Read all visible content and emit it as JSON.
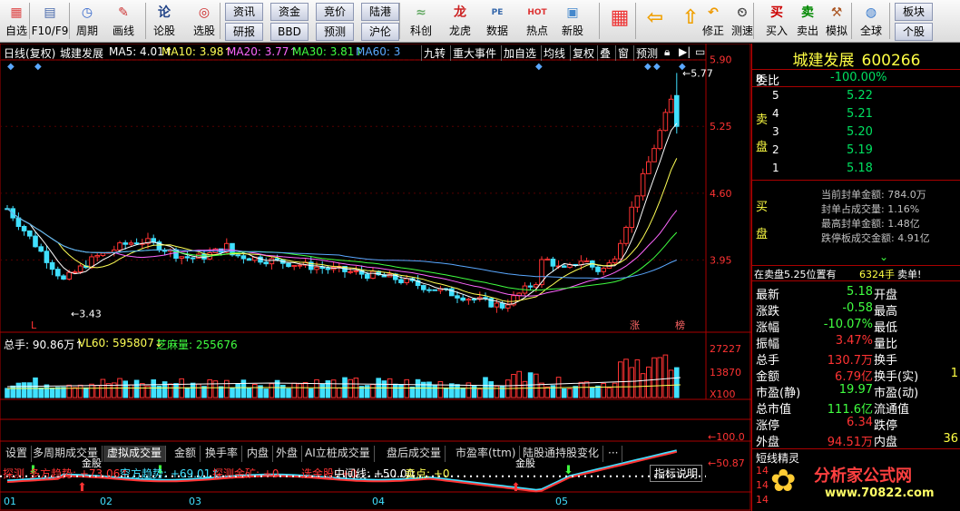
{
  "toolbar": {
    "items": [
      {
        "label": "自选",
        "icon": "grid-icon"
      },
      {
        "label": "F10/F9",
        "icon": "f10-icon"
      },
      {
        "label": "周期",
        "icon": "clock-icon"
      },
      {
        "label": "画线",
        "icon": "pencil-icon"
      },
      {
        "label": "论股",
        "icon": "discuss-icon"
      },
      {
        "label": "选股",
        "icon": "select-stock-icon"
      },
      {
        "label": "科创",
        "icon": "sci-tech-icon"
      },
      {
        "label": "龙虎",
        "icon": "dragon-tiger-icon"
      },
      {
        "label": "数据",
        "icon": "pe-data-icon"
      },
      {
        "label": "热点",
        "icon": "hot-icon"
      },
      {
        "label": "新股",
        "icon": "ipo-icon"
      },
      {
        "label": "修正",
        "icon": "undo-icon"
      },
      {
        "label": "测速",
        "icon": "speed-test-icon"
      },
      {
        "label": "买入",
        "icon": "buy-icon"
      },
      {
        "label": "卖出",
        "icon": "sell-icon"
      },
      {
        "label": "模拟",
        "icon": "hammer-icon"
      },
      {
        "label": "全球",
        "icon": "globe-icon"
      }
    ],
    "small_buttons": [
      "资讯",
      "资金",
      "竞价",
      "陆港",
      "研报",
      "BBD",
      "预测",
      "沪伦",
      "板块",
      "个股"
    ]
  },
  "header": {
    "period": "日线(复权)",
    "stock": "城建发展",
    "ma": [
      {
        "label": "MA5: 4.01",
        "color": "#ffffff"
      },
      {
        "label": "MA10: 3.98",
        "color": "#ffff55"
      },
      {
        "label": "MA20: 3.77",
        "color": "#ff66ff"
      },
      {
        "label": "MA30: 3.81",
        "color": "#40ff40"
      },
      {
        "label": "MA60: 3",
        "color": "#5aa8ff"
      }
    ],
    "tools": [
      "九转",
      "重大事件",
      "加自选",
      "均线",
      "复权",
      "叠",
      "窗",
      "预测"
    ]
  },
  "price_axis": [
    "5.90",
    "5.25",
    "4.60",
    "3.95"
  ],
  "annotations": {
    "high": "5.77",
    "low": "3.43",
    "limit_up": "涨",
    "rank": "榜",
    "low_marker": "L"
  },
  "volume": {
    "total": "总手: 90.86万",
    "vl60": "VL60: 595807",
    "vol_label": "芝麻量: 255676",
    "axis": [
      "27227",
      "13870",
      "X100"
    ]
  },
  "param_tabs": [
    "设置",
    "多周期成交量",
    "虚拟成交量",
    "金额",
    "换手率",
    "内盘",
    "外盘",
    "AI立桩成交量",
    "盘后成交量",
    "市盈率(ttm)",
    "陆股通持股变化",
    "···"
  ],
  "indicator": {
    "name": "探测",
    "items": [
      "多方趋势: +73.06",
      "空方趋势: +69.01",
      "探测金矿: +0",
      "选金股: +0",
      "中间线: +50.00",
      "卖点: +0"
    ],
    "explain": "指标说明",
    "axis": [
      "100.0",
      "50.87"
    ],
    "gold": "金股"
  },
  "months": [
    "01",
    "02",
    "03",
    "04",
    "05"
  ],
  "quote": {
    "name": "城建发展",
    "code": "600266",
    "r": "R",
    "weibi_label": "委比",
    "weibi": "-100.00%",
    "sell_label": "卖盘",
    "buy_label": "买盘",
    "sells": [
      {
        "lvl": "5",
        "price": "5.22"
      },
      {
        "lvl": "4",
        "price": "5.21"
      },
      {
        "lvl": "3",
        "price": "5.20"
      },
      {
        "lvl": "2",
        "price": "5.19"
      },
      {
        "lvl": "1",
        "price": "5.18"
      }
    ],
    "limit_info": [
      "当前封单金额: 784.0万",
      "封单占成交量: 1.16%",
      "最高封单金额: 1.48亿",
      "跌停板成交金额: 4.91亿"
    ],
    "order_line": "在卖盘5.25位置有",
    "order_qty": "6324手",
    "order_word": "卖单!",
    "stats": [
      {
        "l": "最新",
        "v": "5.18",
        "l2": "开盘",
        "v2": ""
      },
      {
        "l": "涨跌",
        "v": "-0.58",
        "l2": "最高",
        "v2": ""
      },
      {
        "l": "涨幅",
        "v": "-10.07%",
        "l2": "最低",
        "v2": ""
      },
      {
        "l": "振幅",
        "v": "3.47%",
        "l2": "量比",
        "v2": ""
      },
      {
        "l": "总手",
        "v": "130.7万",
        "l2": "换手",
        "v2": ""
      },
      {
        "l": "金额",
        "v": "6.79亿",
        "l2": "换手(实)",
        "v2": "1"
      },
      {
        "l": "市盈(静)",
        "v": "19.97",
        "l2": "市盈(动)",
        "v2": ""
      },
      {
        "l": "总市值",
        "v": "111.6亿",
        "l2": "流通值",
        "v2": ""
      },
      {
        "l": "涨停",
        "v": "6.34",
        "l2": "跌停",
        "v2": ""
      },
      {
        "l": "外盘",
        "v": "94.51万",
        "l2": "内盘",
        "v2": "36"
      }
    ],
    "short_title": "短线精灵"
  },
  "watermark": {
    "text": "分析家公式网",
    "url": "www.70822.com"
  }
}
